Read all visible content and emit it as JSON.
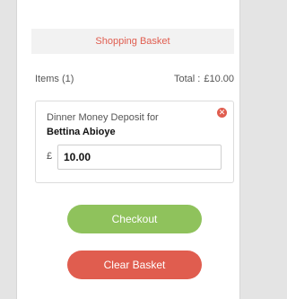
{
  "basket": {
    "title": "Shopping Basket",
    "items_label": "Items (1)",
    "total_label": "Total :",
    "total_value": "£10.00"
  },
  "item": {
    "description": "Dinner Money Deposit for",
    "name": "Bettina Abioye",
    "currency_symbol": "£",
    "amount": "10.00",
    "remove_icon": "remove-icon"
  },
  "actions": {
    "checkout_label": "Checkout",
    "clear_label": "Clear Basket"
  },
  "colors": {
    "accent": "#e05d4f",
    "checkout": "#8fc25c"
  }
}
